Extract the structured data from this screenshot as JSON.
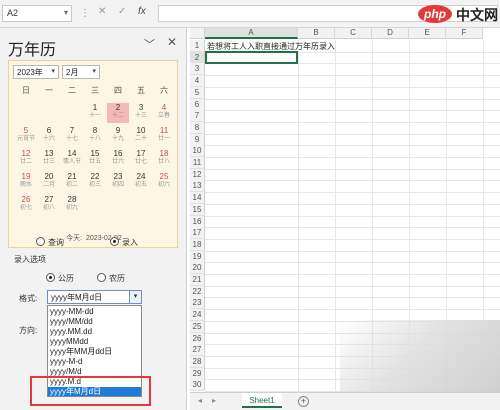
{
  "formula_bar": {
    "name_box": "A2",
    "fx_label": "fx",
    "cancel_glyph": "✕",
    "confirm_glyph": "✓",
    "separator": "⋮",
    "formula": ""
  },
  "pane": {
    "title": "万年历",
    "calendar": {
      "year": "2023年",
      "month": "2月",
      "weekdays": [
        "日",
        "一",
        "二",
        "三",
        "四",
        "五",
        "六"
      ],
      "rows": [
        [
          null,
          null,
          null,
          {
            "n": "1",
            "s": "十一"
          },
          {
            "n": "2",
            "s": "十二"
          },
          {
            "n": "3",
            "s": "十三"
          },
          {
            "n": "4",
            "s": "立春"
          }
        ],
        [
          {
            "n": "5",
            "s": "元宵节"
          },
          {
            "n": "6",
            "s": "十六"
          },
          {
            "n": "7",
            "s": "十七"
          },
          {
            "n": "8",
            "s": "十八"
          },
          {
            "n": "9",
            "s": "十九"
          },
          {
            "n": "10",
            "s": "二十"
          },
          {
            "n": "11",
            "s": "廿一"
          }
        ],
        [
          {
            "n": "12",
            "s": "廿二"
          },
          {
            "n": "13",
            "s": "廿三"
          },
          {
            "n": "14",
            "s": "情人节"
          },
          {
            "n": "15",
            "s": "廿五"
          },
          {
            "n": "16",
            "s": "廿六"
          },
          {
            "n": "17",
            "s": "廿七"
          },
          {
            "n": "18",
            "s": "廿八"
          }
        ],
        [
          {
            "n": "19",
            "s": "雨水"
          },
          {
            "n": "20",
            "s": "二月"
          },
          {
            "n": "21",
            "s": "初二"
          },
          {
            "n": "22",
            "s": "初三"
          },
          {
            "n": "23",
            "s": "初四"
          },
          {
            "n": "24",
            "s": "初五"
          },
          {
            "n": "25",
            "s": "初六"
          }
        ],
        [
          {
            "n": "26",
            "s": "初七"
          },
          {
            "n": "27",
            "s": "初八"
          },
          {
            "n": "28",
            "s": "初九"
          },
          null,
          null,
          null,
          null
        ]
      ],
      "today_label": "今天",
      "today_date": "2023-02-02"
    },
    "mode": {
      "query": "查询",
      "enter": "录入",
      "selected": "enter"
    },
    "options_label": "录入选项",
    "calendar_type": {
      "solar": "公历",
      "lunar": "农历",
      "selected": "solar"
    },
    "format_label": "格式:",
    "format_value": "yyyy年M月d日",
    "format_options": [
      "yyyy-MM-dd",
      "yyyy/MM/dd",
      "yyyy.MM.dd",
      "yyyyMMdd",
      "yyyy年MM月dd日",
      "yyyy-M-d",
      "yyyy/M/d",
      "yyyy.M.d",
      "yyyy年M月d日"
    ],
    "format_highlighted": "yyyy年M月d日",
    "direction_label": "方向:"
  },
  "sheet": {
    "columns": [
      "A",
      "B",
      "C",
      "D",
      "E",
      "F"
    ],
    "active_column": "A",
    "rows": [
      "1",
      "2",
      "3",
      "4",
      "5",
      "6",
      "7",
      "8",
      "9",
      "10",
      "11",
      "12",
      "13",
      "14",
      "15",
      "16",
      "17",
      "18",
      "19",
      "20",
      "21",
      "22",
      "23",
      "24",
      "25",
      "26",
      "27",
      "28",
      "29",
      "30"
    ],
    "active_row": "2",
    "cell_a1": "若想将工人入职直接通过万年历录入",
    "tab": "Sheet1",
    "add_glyph": "+"
  },
  "watermark": {
    "logo": "php",
    "text": "中文网"
  },
  "colors": {
    "accent": "#217346",
    "highlight": "#1e7bd8",
    "today_bg": "#f4b8b8",
    "callout": "#e4393c",
    "calendar_bg": "#fdf6e4"
  }
}
